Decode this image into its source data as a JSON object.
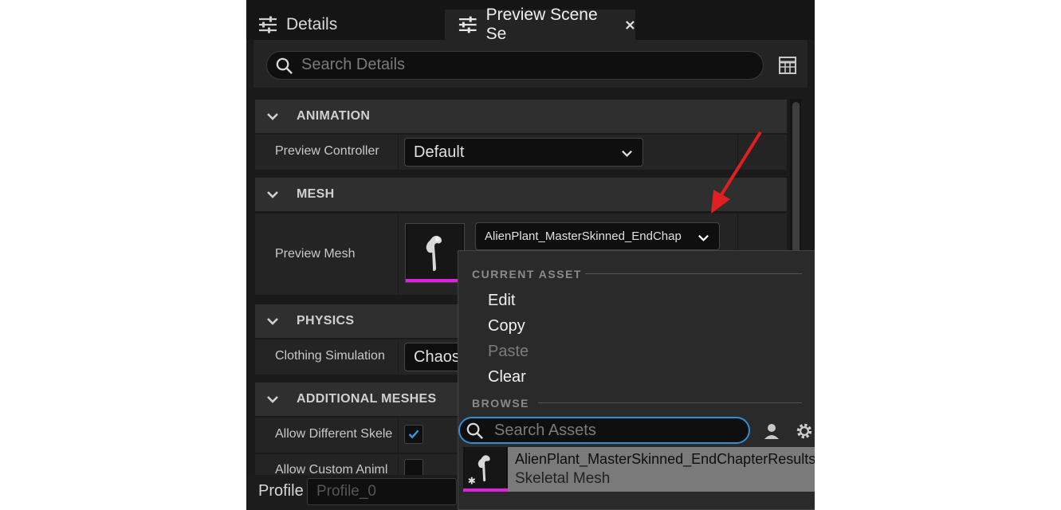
{
  "tabs": [
    {
      "label": "Details"
    },
    {
      "label": "Preview Scene Se"
    }
  ],
  "search": {
    "placeholder": "Search Details"
  },
  "sections": {
    "animation": {
      "title": "ANIMATION",
      "rows": [
        {
          "label": "Preview Controller",
          "value": "Default"
        }
      ]
    },
    "mesh": {
      "title": "MESH",
      "rows": [
        {
          "label": "Preview Mesh",
          "value": "AlienPlant_MasterSkinned_EndChap"
        }
      ]
    },
    "physics": {
      "title": "PHYSICS",
      "rows": [
        {
          "label": "Clothing Simulation",
          "value": "Chaos"
        }
      ]
    },
    "additional": {
      "title": "ADDITIONAL MESHES",
      "rows": [
        {
          "label": "Allow Different Skele",
          "checked": true
        },
        {
          "label": "Allow Custom Animl",
          "checked": false
        }
      ]
    }
  },
  "profile": {
    "label": "Profile",
    "value": "Profile_0"
  },
  "context_menu": {
    "current_asset_header": "CURRENT ASSET",
    "items": [
      {
        "label": "Edit",
        "enabled": true
      },
      {
        "label": "Copy",
        "enabled": true
      },
      {
        "label": "Paste",
        "enabled": false
      },
      {
        "label": "Clear",
        "enabled": true
      }
    ],
    "browse_header": "BROWSE",
    "search_placeholder": "Search Assets",
    "results": [
      {
        "name": "AlienPlant_MasterSkinned_EndChapterResults",
        "type": "Skeletal Mesh"
      }
    ]
  },
  "colors": {
    "panel_bg": "#1a1a1a",
    "accent_focus": "#2e8ed6",
    "asset_underline": "#e020e0",
    "checkmark": "#2e9be6",
    "annotation_arrow": "#e02020"
  }
}
